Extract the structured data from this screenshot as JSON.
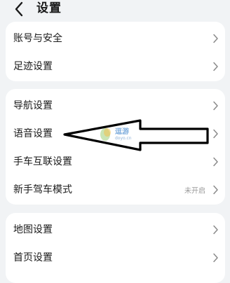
{
  "header": {
    "title": "设置",
    "back_icon": "chevron-left-icon"
  },
  "groups": [
    {
      "items": [
        {
          "label": "账号与安全"
        },
        {
          "label": "足迹设置"
        }
      ]
    },
    {
      "items": [
        {
          "label": "导航设置"
        },
        {
          "label": "语音设置"
        },
        {
          "label": "手车互联设置"
        },
        {
          "label": "新手驾车模式",
          "value": "未开启"
        }
      ]
    },
    {
      "items": [
        {
          "label": "地图设置"
        },
        {
          "label": "首页设置"
        }
      ]
    }
  ],
  "watermark": {
    "text": "逗游",
    "url": "doyo.cn"
  },
  "colors": {
    "background": "#f1f3f5",
    "card": "#ffffff",
    "text": "#1a1a1a",
    "secondary_text": "#9a9a9a",
    "chevron": "#8a8a8a",
    "annotation_arrow": "#000000"
  }
}
